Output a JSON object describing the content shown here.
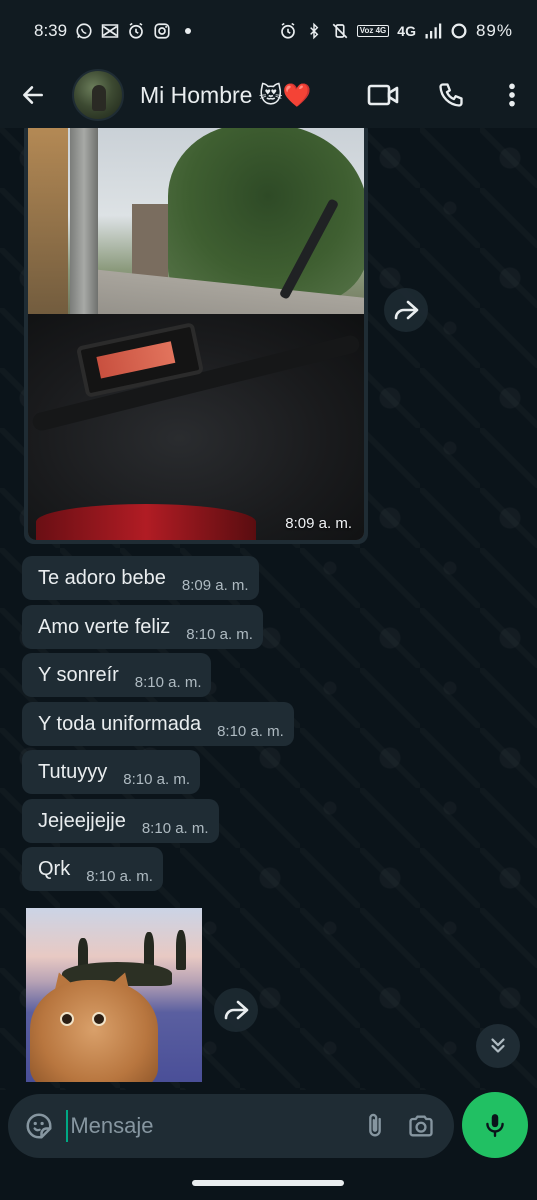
{
  "status_bar": {
    "time": "8:39",
    "network": "4G",
    "volte": "Voz 4G",
    "battery": "89%"
  },
  "header": {
    "contact_name": "Mi Hombre 😻❤️"
  },
  "messages": [
    {
      "type": "image",
      "time": "8:09 a. m."
    },
    {
      "type": "text",
      "text": "Te adoro bebe",
      "time": "8:09 a. m."
    },
    {
      "type": "text",
      "text": "Amo verte feliz",
      "time": "8:10 a. m."
    },
    {
      "type": "text",
      "text": "Y sonreír",
      "time": "8:10 a. m."
    },
    {
      "type": "text",
      "text": "Y toda uniformada",
      "time": "8:10 a. m."
    },
    {
      "type": "text",
      "text": "Tutuyyy",
      "time": "8:10 a. m."
    },
    {
      "type": "text",
      "text": "Jejeejjejje",
      "time": "8:10 a. m."
    },
    {
      "type": "text",
      "text": "Qrk",
      "time": "8:10 a. m."
    },
    {
      "type": "sticker"
    }
  ],
  "input": {
    "placeholder": "Mensaje"
  },
  "colors": {
    "background": "#0b141a",
    "bar": "#111b21",
    "bubble_incoming": "#1f2c34",
    "accent_green": "#21c063",
    "caret": "#00a884"
  },
  "icons": [
    "back-arrow-icon",
    "video-call-icon",
    "phone-icon",
    "more-vert-icon",
    "forward-icon",
    "chevrons-down-icon",
    "emoji-sticker-icon",
    "paperclip-icon",
    "camera-icon",
    "mic-icon"
  ]
}
